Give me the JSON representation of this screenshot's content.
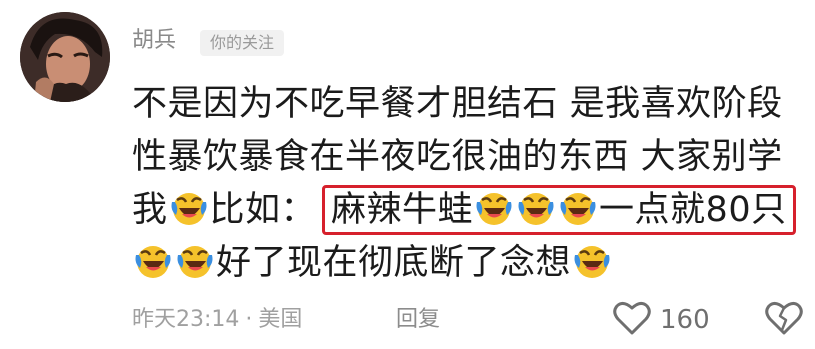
{
  "comment": {
    "username": "胡兵",
    "follow_badge": "你的关注",
    "line1": "不是因为不吃早餐才胆结石 是我喜欢阶段",
    "line2": "性暴饮暴食在半夜吃很油的东西 大家别学",
    "line3_a": "我",
    "line3_b": "比如：",
    "highlight_a": "麻辣牛蛙",
    "highlight_b": "一点就80只",
    "line4": "好了现在彻底断了念想",
    "emoji_name": "laughing-tears-emoji"
  },
  "meta": {
    "time": "昨天23:14",
    "separator": "·",
    "location": "美国",
    "reply_label": "回复",
    "like_count": "160"
  },
  "icons": {
    "like": "heart-icon",
    "dislike": "broken-heart-icon"
  },
  "colors": {
    "highlight_border": "#d6202c",
    "emoji_yellow": "#f5c22b",
    "text": "#1b1b1b",
    "meta": "#a0a0a0"
  }
}
